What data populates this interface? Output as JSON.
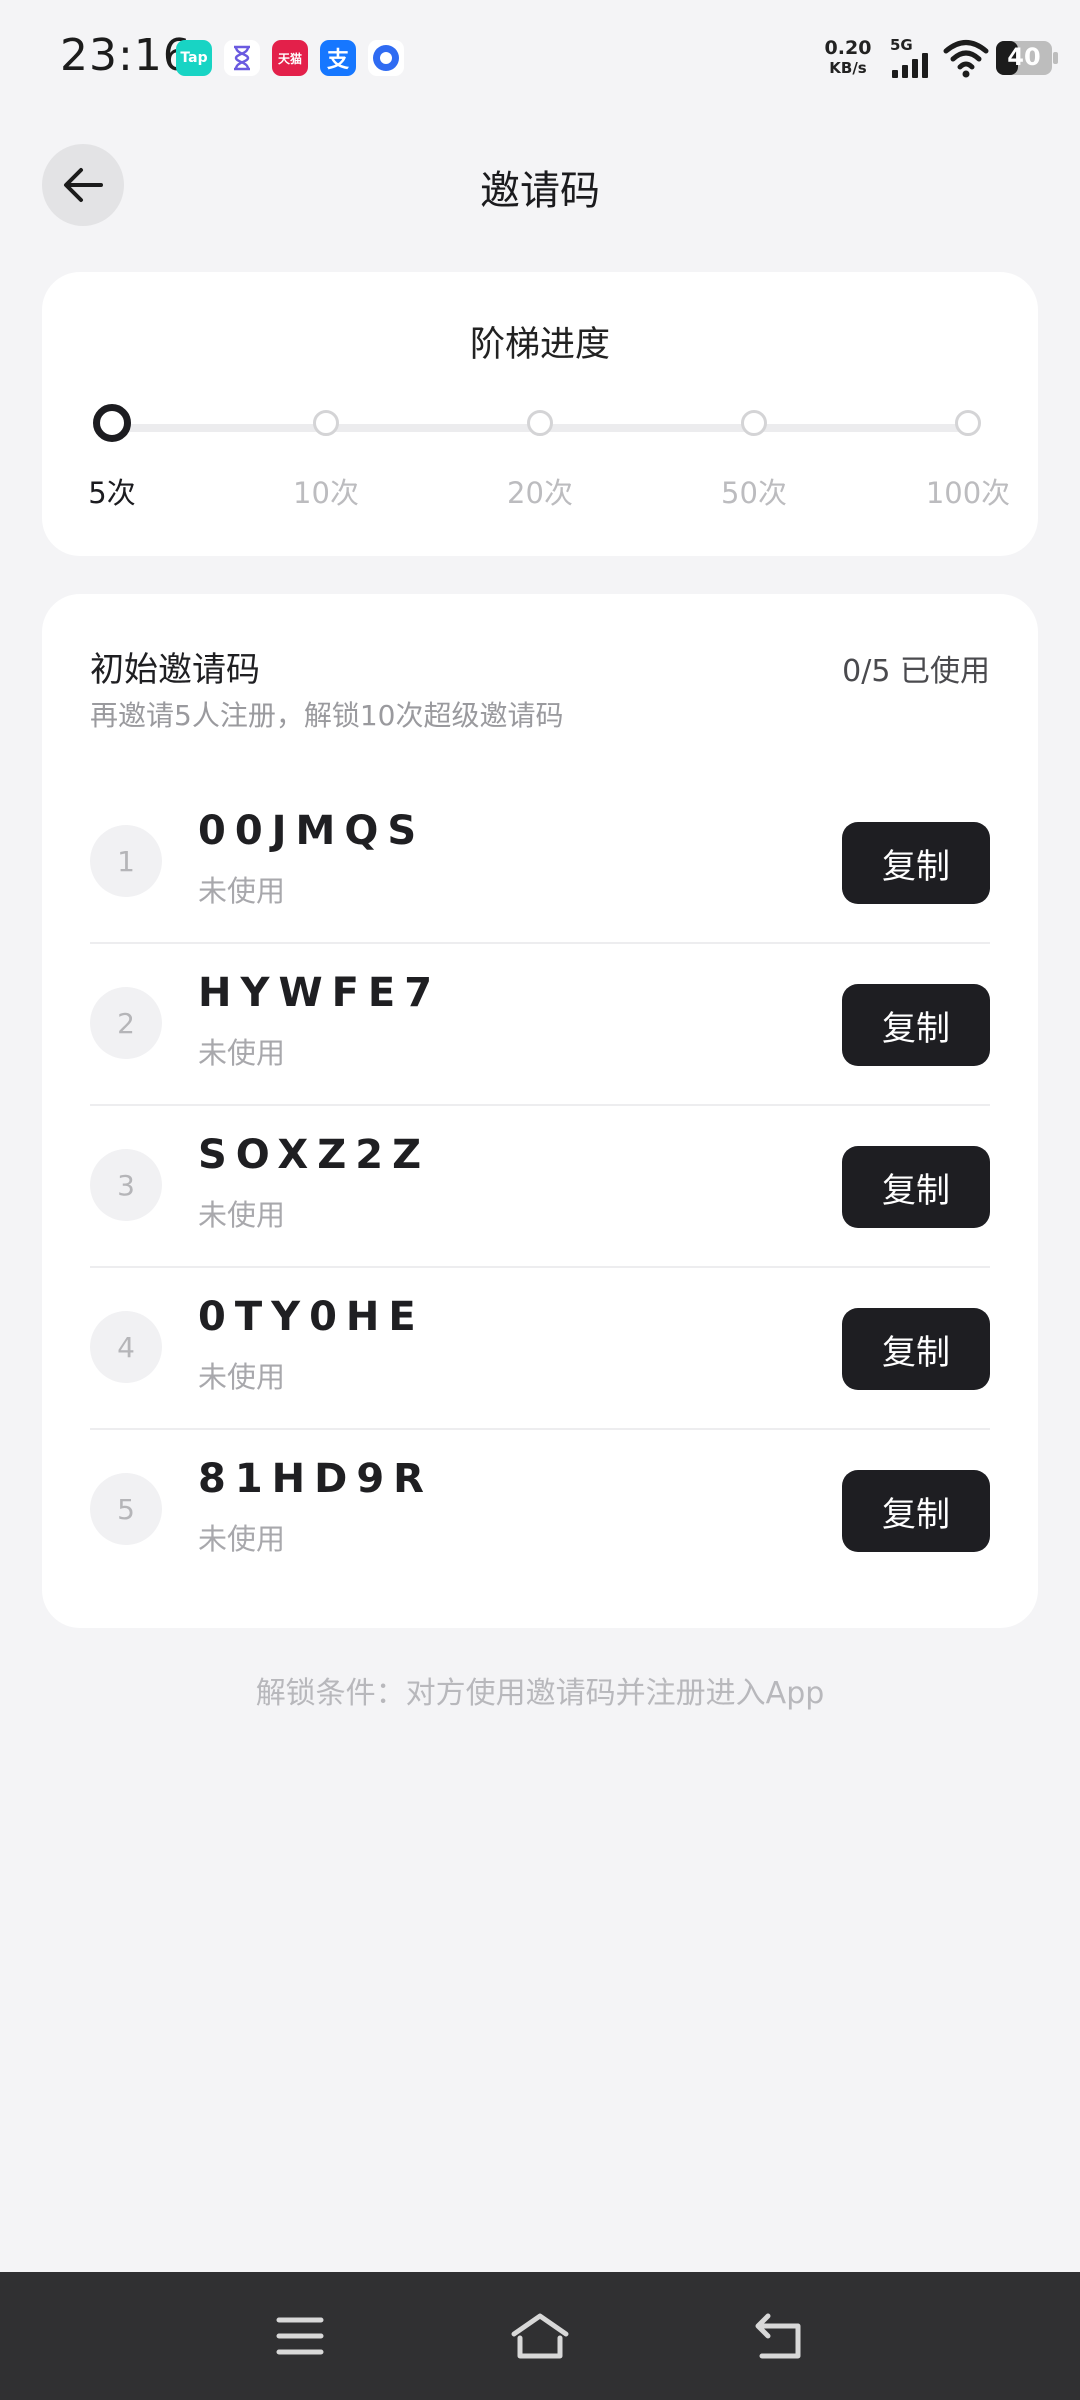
{
  "status_bar": {
    "time": "23:16",
    "net_speed_value": "0.20",
    "net_speed_unit": "KB/s",
    "network_type": "5G",
    "battery": "40",
    "app_icons": [
      {
        "name": "tap-icon",
        "label": "Tap",
        "color": "#18d4c4"
      },
      {
        "name": "hourglass-icon",
        "label": "⏳",
        "color": "#ffffff"
      },
      {
        "name": "tmall-icon",
        "label": "天猫",
        "color": "#e3204a"
      },
      {
        "name": "alipay-icon",
        "label": "支",
        "color": "#1677ff"
      },
      {
        "name": "circle-app-icon",
        "label": "",
        "color": "#2f6bf2"
      }
    ]
  },
  "header": {
    "title": "邀请码"
  },
  "progress": {
    "title": "阶梯进度",
    "steps": [
      {
        "label": "5次",
        "active": true
      },
      {
        "label": "10次",
        "active": false
      },
      {
        "label": "20次",
        "active": false
      },
      {
        "label": "50次",
        "active": false
      },
      {
        "label": "100次",
        "active": false
      }
    ]
  },
  "codes": {
    "title": "初始邀请码",
    "subtitle": "再邀请5人注册，解锁10次超级邀请码",
    "used_summary": "0/5 已使用",
    "copy_label": "复制",
    "items": [
      {
        "index": "1",
        "code": "00JMQS",
        "status": "未使用"
      },
      {
        "index": "2",
        "code": "HYWFE7",
        "status": "未使用"
      },
      {
        "index": "3",
        "code": "SOXZ2Z",
        "status": "未使用"
      },
      {
        "index": "4",
        "code": "0TY0HE",
        "status": "未使用"
      },
      {
        "index": "5",
        "code": "81HD9R",
        "status": "未使用"
      }
    ]
  },
  "footnote": "解锁条件：对方使用邀请码并注册进入App",
  "colors": {
    "background": "#f4f4f6",
    "card": "#ffffff",
    "accent_dark": "#1e1e22",
    "muted_text": "#a8a8ac",
    "nav_bar": "#303032"
  }
}
